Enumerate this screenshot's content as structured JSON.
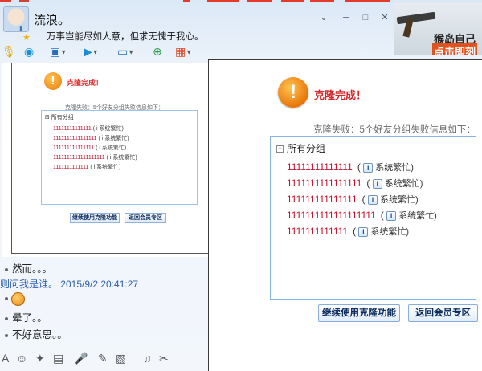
{
  "chat": {
    "contact_name": "流浪。",
    "signature": "万事岂能尽如人意，但求无愧于我心。",
    "ad": {
      "line1": "猴岛自己",
      "line2": "点击即刻"
    },
    "messages": [
      "然而。。。",
      "则问我是谁。 2015/9/2 20:41:27",
      "晕了。。",
      "不好意思。。"
    ]
  },
  "dialog": {
    "title": "克隆完成！",
    "subtitle": "克隆失败：5个好友分组失败信息如下：",
    "group_name": "所有分组",
    "failures": [
      {
        "id": "11111111111111",
        "reason": "系统繁忙"
      },
      {
        "id": "1111111111111111",
        "reason": "系统繁忙"
      },
      {
        "id": "111111111111111",
        "reason": "系统繁忙"
      },
      {
        "id": "1111111111111111111",
        "reason": "系统繁忙"
      },
      {
        "id": "1111111111111",
        "reason": "系统繁忙"
      }
    ],
    "continue_button": "继续使用克隆功能",
    "member_button": "返回会员专区"
  },
  "mini_screenshot": {
    "title": "克隆完成！",
    "subtitle": "克隆失败：5个好友分组失败信息如下：",
    "group_name": "所有分组",
    "failures": [
      {
        "id": "11111111111111",
        "reason": "系统繁忙"
      },
      {
        "id": "1111111111111111",
        "reason": "系统繁忙"
      },
      {
        "id": "111111111111111",
        "reason": "系统繁忙"
      },
      {
        "id": "1111111111111111111",
        "reason": "系统繁忙"
      },
      {
        "id": "1111111111111",
        "reason": "系统繁忙"
      }
    ],
    "continue_button": "继续使用克隆功能",
    "member_button": "返回会员专区"
  },
  "colors": {
    "accent_red": "#d8282b",
    "failure_red": "#c4112c",
    "button_text": "#0d2d60"
  },
  "icons": [
    "warning-icon",
    "info-icon",
    "minimize-icon",
    "maximize-icon",
    "close-icon",
    "emoji-icon",
    "voice-icon",
    "video-icon",
    "file-icon",
    "screen-share-icon",
    "apps-icon"
  ]
}
